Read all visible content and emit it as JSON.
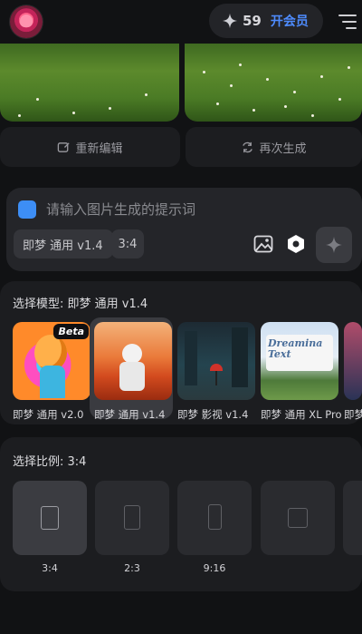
{
  "header": {
    "credits": "59",
    "vip_label": "开会员"
  },
  "actions": {
    "reedit_label": "重新编辑",
    "regenerate_label": "再次生成"
  },
  "prompt": {
    "placeholder": "请输入图片生成的提示词",
    "value": "",
    "model_chip": "即梦 通用 v1.4",
    "ratio_chip": "3:4"
  },
  "model_section": {
    "title": "选择模型: 即梦 通用 v1.4",
    "models": [
      {
        "name": "即梦 通用 v2.0",
        "badge": "Beta",
        "selected": false
      },
      {
        "name": "即梦 通用 v1.4",
        "selected": true
      },
      {
        "name": "即梦 影视 v1.4",
        "selected": false
      },
      {
        "name": "即梦 通用 XL Pro",
        "thumb_text": "Dreamina Text",
        "selected": false
      },
      {
        "name": "即梦",
        "selected": false
      }
    ]
  },
  "ratio_section": {
    "title": "选择比例: 3:4",
    "ratios": [
      {
        "label": "3:4",
        "selected": true
      },
      {
        "label": "2:3",
        "selected": false
      },
      {
        "label": "9:16",
        "selected": false
      },
      {
        "label": "",
        "selected": false
      },
      {
        "label": "",
        "selected": false
      }
    ]
  },
  "colors": {
    "accent": "#4e8cff",
    "checkbox": "#3d8ef5",
    "background": "#111214",
    "card": "#1c1d20"
  },
  "icons": [
    "sparkle-icon",
    "menu-icon",
    "edit-icon",
    "refresh-icon",
    "image-icon",
    "hexagon-icon"
  ]
}
